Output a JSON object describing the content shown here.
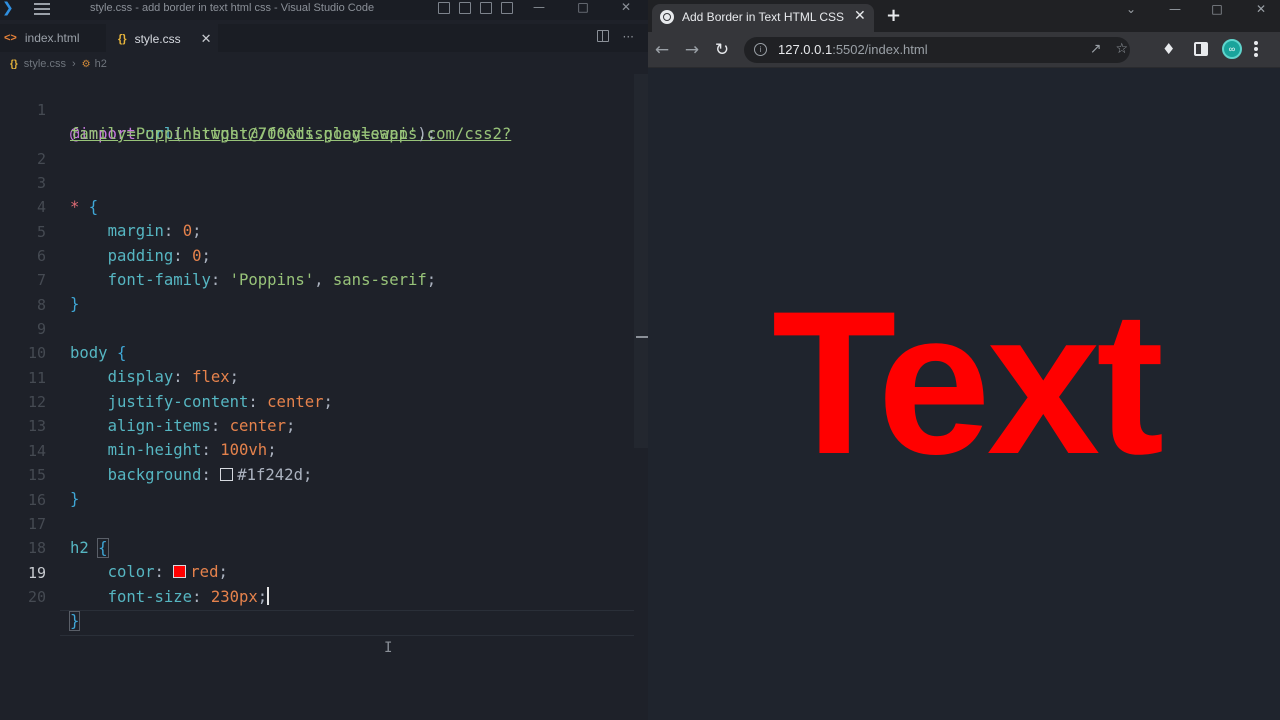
{
  "vscode": {
    "window_title": "style.css - add border in text html css - Visual Studio Code",
    "tabs": [
      {
        "label": "index.html",
        "icon": "html-file-icon"
      },
      {
        "label": "style.css",
        "icon": "css-file-icon",
        "active": true
      }
    ],
    "breadcrumb": {
      "file": "style.css",
      "symbol": "h2"
    },
    "current_line": 19,
    "code_lines": [
      {
        "n": "1",
        "t": "@import url('https://fonts.googleapis.com/css2?"
      },
      {
        "n": "",
        "t": "family=Poppins:wght@700&display=swap');"
      },
      {
        "n": "2",
        "t": ""
      },
      {
        "n": "3",
        "t": "* {"
      },
      {
        "n": "4",
        "t": "    margin: 0;"
      },
      {
        "n": "5",
        "t": "    padding: 0;"
      },
      {
        "n": "6",
        "t": "    font-family: 'Poppins', sans-serif;"
      },
      {
        "n": "7",
        "t": "}"
      },
      {
        "n": "8",
        "t": ""
      },
      {
        "n": "9",
        "t": "body {"
      },
      {
        "n": "10",
        "t": "    display: flex;"
      },
      {
        "n": "11",
        "t": "    justify-content: center;"
      },
      {
        "n": "12",
        "t": "    align-items: center;"
      },
      {
        "n": "13",
        "t": "    min-height: 100vh;"
      },
      {
        "n": "14",
        "t": "    background: #1f242d;"
      },
      {
        "n": "15",
        "t": "}"
      },
      {
        "n": "16",
        "t": ""
      },
      {
        "n": "17",
        "t": "h2 {"
      },
      {
        "n": "18",
        "t": "    color: red;"
      },
      {
        "n": "19",
        "t": "    font-size: 230px;"
      },
      {
        "n": "20",
        "t": "}"
      }
    ],
    "swatch_colors": {
      "background": "#1f242d",
      "red": "#ff0000"
    }
  },
  "browser": {
    "tab_title": "Add Border in Text HTML CSS | C",
    "url_host": "127.0.0.1",
    "url_rest": ":5502/index.html",
    "page": {
      "heading": "Text",
      "heading_color": "#ff0000",
      "background": "#1f242d"
    }
  }
}
